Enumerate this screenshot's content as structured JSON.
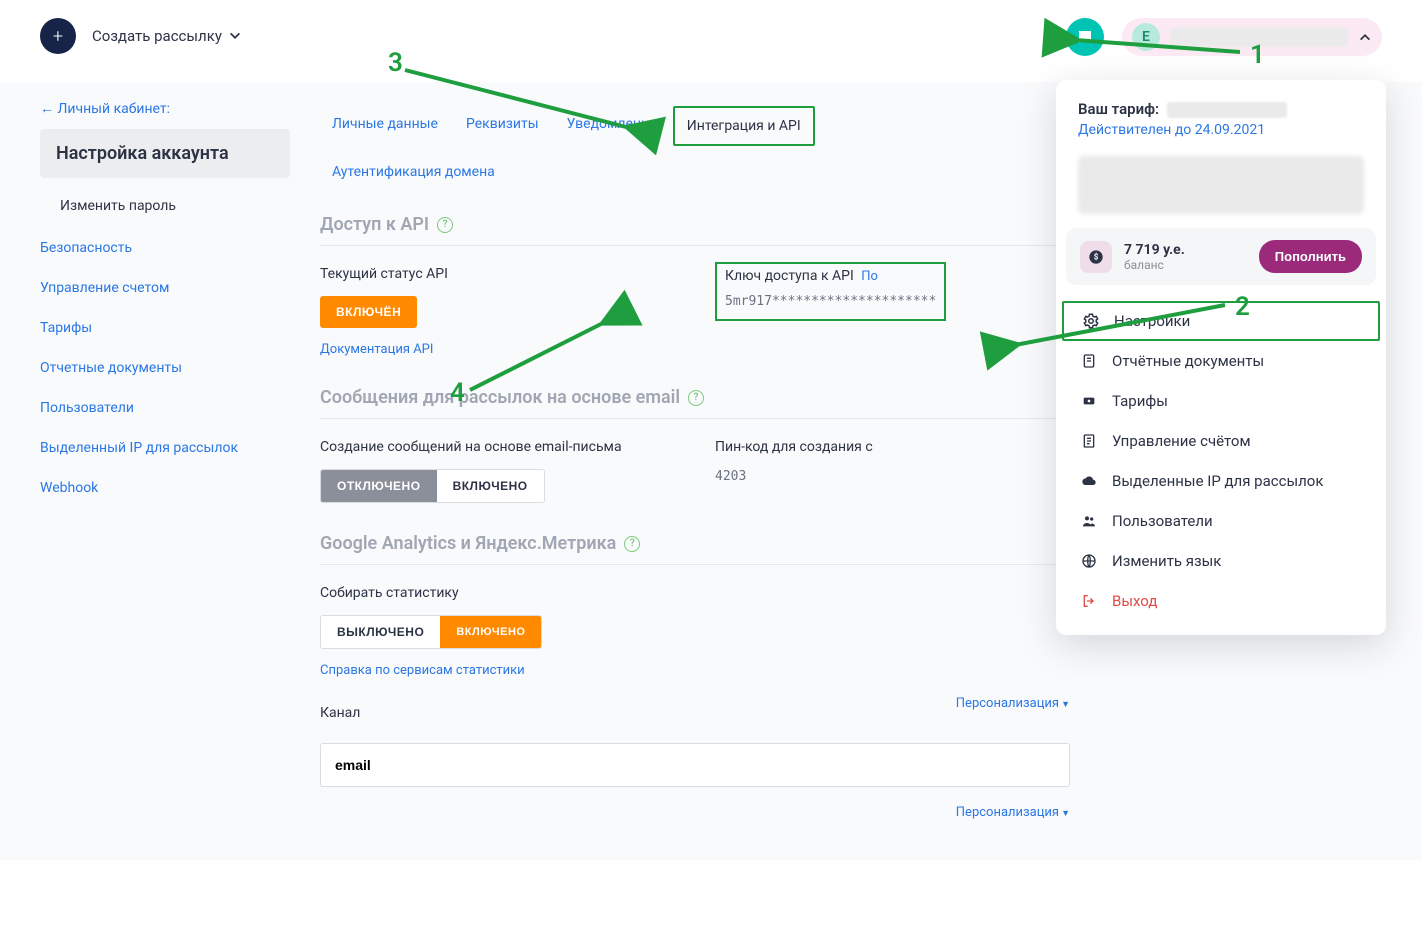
{
  "topbar": {
    "create_label": "Создать рассылку",
    "user_initial": "E"
  },
  "sidebar": {
    "back": "← Личный кабинет:",
    "active": "Настройка аккаунта",
    "sub": "Изменить пароль",
    "links": [
      "Безопасность",
      "Управление счетом",
      "Тарифы",
      "Отчетные документы",
      "Пользователи",
      "Выделенный IP для рассылок",
      "Webhook"
    ]
  },
  "tabs": {
    "items": [
      "Личные данные",
      "Реквизиты",
      "Уведомления",
      "Интеграция и API",
      "Аутентификация домена"
    ],
    "active_index": 3
  },
  "api": {
    "heading": "Доступ к API",
    "status_label": "Текущий статус API",
    "status_btn": "ВКЛЮЧЁН",
    "doc_link": "Документация API",
    "key_label": "Ключ доступа к API",
    "key_edit": "По",
    "key_value": "5mr917*********************"
  },
  "messages": {
    "heading": "Сообщения для рассылок на основе email",
    "create_label": "Создание сообщений на основе email-письма",
    "off": "ОТКЛЮЧЕНО",
    "on": "ВКЛЮЧЕНО",
    "pin_label": "Пин-код для создания с",
    "pin_value": "4203"
  },
  "analytics": {
    "heading": "Google Analytics и Яндекс.Метрика",
    "collect_label": "Собирать статистику",
    "off": "ВЫКЛЮЧЕНО",
    "on": "ВКЛЮЧЕНО",
    "help_link": "Справка по сервисам статистики",
    "channel_label": "Канал",
    "personalization": "Персонализация",
    "channel_value": "email"
  },
  "dropdown": {
    "tariff_label": "Ваш тариф:",
    "valid_until": "Действителен до 24.09.2021",
    "balance_amount": "7 719 у.е.",
    "balance_label": "баланс",
    "topup": "Пополнить",
    "items": [
      "Настройки",
      "Отчётные документы",
      "Тарифы",
      "Управление счётом",
      "Выделенные IP для рассылок",
      "Пользователи",
      "Изменить язык",
      "Выход"
    ]
  },
  "annotations": {
    "n1": "1",
    "n2": "2",
    "n3": "3",
    "n4": "4"
  }
}
